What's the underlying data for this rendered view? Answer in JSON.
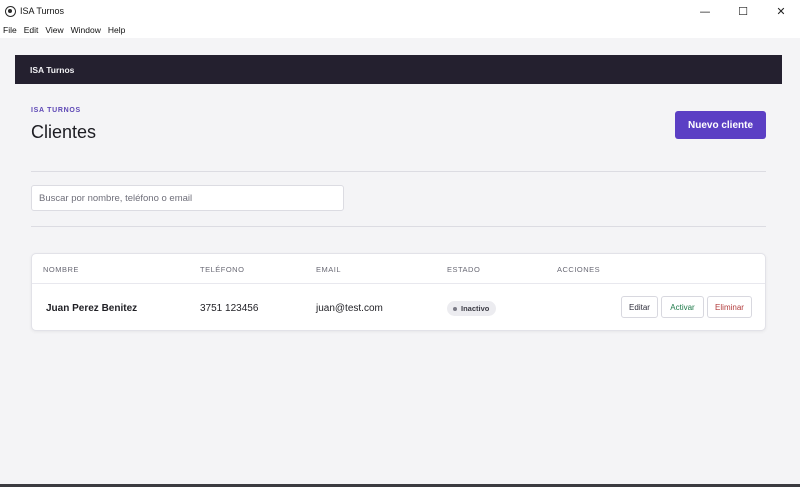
{
  "window": {
    "title": "ISA Turnos",
    "controls": {
      "minimize": "—",
      "maximize": "☐",
      "close": "✕"
    }
  },
  "menu": [
    "File",
    "Edit",
    "View",
    "Window",
    "Help"
  ],
  "app_header": {
    "title": "ISA Turnos"
  },
  "page": {
    "eyebrow": "ISA TURNOS",
    "title": "Clientes",
    "new_button": "Nuevo cliente"
  },
  "search": {
    "placeholder": "Buscar por nombre, teléfono o email",
    "value": ""
  },
  "table": {
    "columns": [
      "NOMBRE",
      "TELÉFONO",
      "EMAIL",
      "ESTADO",
      "ACCIONES"
    ],
    "rows": [
      {
        "name": "Juan Perez Benitez",
        "phone": "3751 123456",
        "email": "juan@test.com",
        "status": "Inactivo",
        "actions": {
          "edit": "Editar",
          "activate": "Activar",
          "delete": "Eliminar"
        }
      }
    ]
  },
  "colors": {
    "header_bg": "#24202f",
    "primary": "#5b3fc4",
    "eyebrow": "#5d47b5",
    "activate": "#1f7a4a",
    "delete": "#b23c3c"
  }
}
